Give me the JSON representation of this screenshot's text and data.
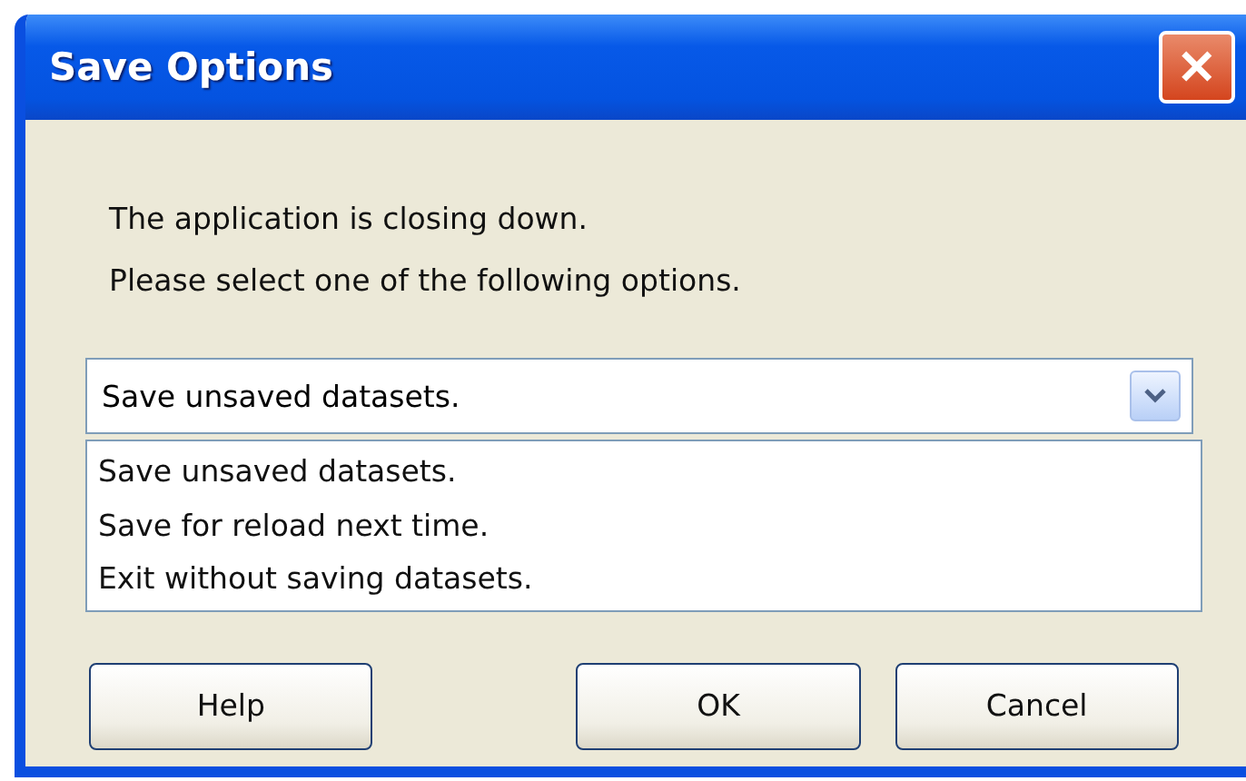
{
  "window": {
    "title": "Save Options",
    "close_glyph": "✕"
  },
  "message": [
    "The application is closing down.",
    "Please select one of the following options."
  ],
  "dropdown": {
    "value": "Save unsaved datasets.",
    "options": [
      "Save unsaved datasets.",
      "Save for reload next time.",
      "Exit without saving datasets."
    ]
  },
  "buttons": [
    {
      "label": "Help"
    },
    {
      "label": "OK"
    },
    {
      "label": "Cancel"
    }
  ]
}
